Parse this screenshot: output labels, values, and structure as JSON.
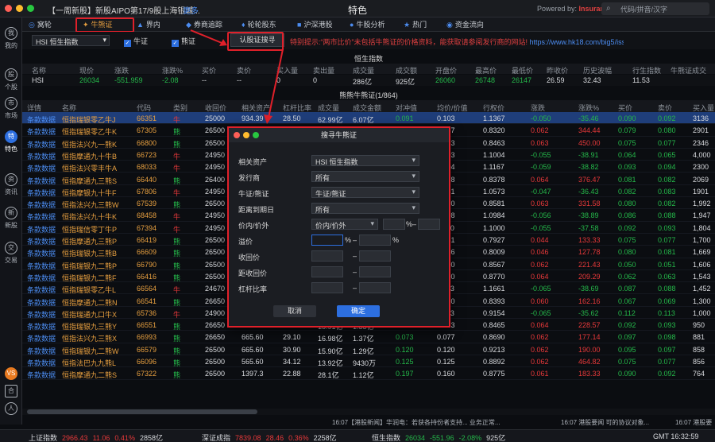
{
  "titlebar": {
    "ticker": "【一周新股】新股AIPO第17/9股上海银城...",
    "more": "更多",
    "title": "特色",
    "powered": "Powered by:",
    "brand": "Insurance",
    "search_placeholder": "代码/拼音/汉字"
  },
  "sidebar": {
    "items": [
      {
        "label": "我的",
        "icon": "我"
      },
      {
        "label": "个股",
        "icon": "股"
      },
      {
        "label": "市场",
        "icon": "市"
      },
      {
        "label": "特色",
        "icon": "特"
      },
      {
        "label": "资讯",
        "icon": "资"
      },
      {
        "label": "新股",
        "icon": "新"
      },
      {
        "label": "交易",
        "icon": "交"
      }
    ],
    "bottom": [
      {
        "icon": "VS"
      },
      {
        "icon": "合"
      },
      {
        "icon": "人"
      }
    ]
  },
  "tabs": [
    {
      "label": "窝轮",
      "icon": "◎"
    },
    {
      "label": "牛熊证",
      "icon": "✦"
    },
    {
      "label": "界内",
      "icon": "▲"
    },
    {
      "label": "券商追踪",
      "icon": "◆"
    },
    {
      "label": "轮轮股东",
      "icon": "♦"
    },
    {
      "label": "沪深港股",
      "icon": "■"
    },
    {
      "label": "牛股分析",
      "icon": "●"
    },
    {
      "label": "热门",
      "icon": "★"
    },
    {
      "label": "资金流向",
      "icon": "◉"
    }
  ],
  "filter": {
    "asset": "HSI 恒生指数",
    "check_bull": "牛证",
    "check_bear": "熊证",
    "search_btn": "认股证搜寻",
    "tip": "特别提示:“两市比价”未包括牛熊证的价格资料，能获取请参阅发行商的网站!",
    "url": "https://www.hk18.com/big5/issuer.htm"
  },
  "index": {
    "title": "恒生指数",
    "headers": [
      "名称",
      "现价",
      "涨跌",
      "涨跌%",
      "买价",
      "卖价",
      "买入量",
      "卖出量",
      "成交量",
      "成交额",
      "开盘价",
      "最高价",
      "最低价",
      "昨收价",
      "历史波幅",
      "行生指数",
      "牛熊证成交"
    ],
    "row": [
      "HSI",
      "26034",
      "-551.959",
      "-2.08",
      "--",
      "--",
      "0",
      "0",
      "286亿",
      "925亿",
      "26060",
      "26748",
      "26147",
      "26.59",
      "32.43",
      "11.53"
    ]
  },
  "table_title": "熊熊牛熊证(1/864)",
  "columns": [
    "详情",
    "名称",
    "代码",
    "类别",
    "收回价",
    "相关资产",
    "杠杆比率",
    "成交量",
    "成交金额",
    "对冲值",
    "均价/价值",
    "行权价",
    "涨跌",
    "涨跌%",
    "买价",
    "卖价",
    "买入量"
  ],
  "rows": [
    {
      "detail": "条款数据",
      "name": "恒指瑞银零乙牛J",
      "code": "66351",
      "type": "牛",
      "recall": "25000",
      "v1": "934.39",
      "v2": "28.50",
      "v3": "62.99亿",
      "v4": "6.07亿",
      "v5": "0.091",
      "v6": "0.103",
      "v7": "1.1367",
      "chg": "-0.050",
      "pct": "-35.46",
      "bid": "0.090",
      "ask": "0.092",
      "vol": "3136"
    },
    {
      "detail": "条款数据",
      "name": "恒指瑞银零乙牛K",
      "code": "67305",
      "type": "熊",
      "recall": "26500",
      "v1": "",
      "v2": "",
      "v3": "",
      "v4": "",
      "v5": "",
      "v6": "0.067",
      "v7": "0.8320",
      "chg": "0.062",
      "pct": "344.44",
      "bid": "0.079",
      "ask": "0.080",
      "vol": "2901"
    },
    {
      "detail": "条款数据",
      "name": "恒指法兴九一熊K",
      "code": "66800",
      "type": "熊",
      "recall": "26500",
      "v1": "",
      "v2": "",
      "v3": "",
      "v4": "",
      "v5": "",
      "v6": "0.063",
      "v7": "0.8463",
      "chg": "0.063",
      "pct": "450.00",
      "bid": "0.075",
      "ask": "0.077",
      "vol": "2346"
    },
    {
      "detail": "条款数据",
      "name": "恒指摩通九十牛B",
      "code": "66723",
      "type": "牛",
      "recall": "24950",
      "v1": "",
      "v2": "",
      "v3": "",
      "v4": "",
      "v5": "",
      "v6": "0.103",
      "v7": "1.1004",
      "chg": "-0.055",
      "pct": "-38.91",
      "bid": "0.064",
      "ask": "0.065",
      "vol": "4,000"
    },
    {
      "detail": "条款数据",
      "name": "恒指法兴零丰牛A",
      "code": "68033",
      "type": "牛",
      "recall": "24950",
      "v1": "",
      "v2": "",
      "v3": "",
      "v4": "",
      "v5": "",
      "v6": "0.104",
      "v7": "1.1167",
      "chg": "-0.059",
      "pct": "-38.82",
      "bid": "0.093",
      "ask": "0.094",
      "vol": "2300"
    },
    {
      "detail": "条款数据",
      "name": "恒指摩通九三熊S",
      "code": "66440",
      "type": "熊",
      "recall": "26400",
      "v1": "",
      "v2": "",
      "v3": "",
      "v4": "",
      "v5": "",
      "v6": "0.078",
      "v7": "0.8378",
      "chg": "0.064",
      "pct": "376.47",
      "bid": "0.081",
      "ask": "0.082",
      "vol": "2069"
    },
    {
      "detail": "条款数据",
      "name": "恒指摩银九十牛F",
      "code": "67806",
      "type": "牛",
      "recall": "24950",
      "v1": "",
      "v2": "",
      "v3": "",
      "v4": "",
      "v5": "",
      "v6": "0.061",
      "v7": "1.0573",
      "chg": "-0.047",
      "pct": "-36.43",
      "bid": "0.082",
      "ask": "0.083",
      "vol": "1901"
    },
    {
      "detail": "条款数据",
      "name": "恒指法兴九三熊W",
      "code": "67539",
      "type": "熊",
      "recall": "26500",
      "v1": "",
      "v2": "",
      "v3": "",
      "v4": "",
      "v5": "",
      "v6": "0.070",
      "v7": "0.8581",
      "chg": "0.063",
      "pct": "331.58",
      "bid": "0.080",
      "ask": "0.082",
      "vol": "1,992"
    },
    {
      "detail": "条款数据",
      "name": "恒指法兴九十牛K",
      "code": "68458",
      "type": "牛",
      "recall": "24950",
      "v1": "",
      "v2": "",
      "v3": "",
      "v4": "",
      "v5": "",
      "v6": "0.108",
      "v7": "1.0984",
      "chg": "-0.056",
      "pct": "-38.89",
      "bid": "0.086",
      "ask": "0.088",
      "vol": "1,947"
    },
    {
      "detail": "条款数据",
      "name": "恒指瑞信零丁牛P",
      "code": "67394",
      "type": "牛",
      "recall": "24950",
      "v1": "",
      "v2": "",
      "v3": "",
      "v4": "",
      "v5": "",
      "v6": "0.110",
      "v7": "1.1000",
      "chg": "-0.055",
      "pct": "-37.58",
      "bid": "0.092",
      "ask": "0.093",
      "vol": "1,804"
    },
    {
      "detail": "条款数据",
      "name": "恒指摩通九三熊P",
      "code": "66419",
      "type": "熊",
      "recall": "26500",
      "v1": "",
      "v2": "",
      "v3": "",
      "v4": "",
      "v5": "",
      "v6": "0.081",
      "v7": "0.7927",
      "chg": "0.044",
      "pct": "133.33",
      "bid": "0.075",
      "ask": "0.077",
      "vol": "1,700"
    },
    {
      "detail": "条款数据",
      "name": "恒指瑞银九三熊B",
      "code": "66609",
      "type": "熊",
      "recall": "26500",
      "v1": "",
      "v2": "",
      "v3": "",
      "v4": "",
      "v5": "",
      "v6": "0.086",
      "v7": "0.8009",
      "chg": "0.046",
      "pct": "127.78",
      "bid": "0.080",
      "ask": "0.081",
      "vol": "1,669"
    },
    {
      "detail": "条款数据",
      "name": "恒指瑞银九二熊P",
      "code": "66790",
      "type": "熊",
      "recall": "26500",
      "v1": "",
      "v2": "",
      "v3": "",
      "v4": "",
      "v5": "",
      "v6": "0.090",
      "v7": "0.8567",
      "chg": "0.062",
      "pct": "221.43",
      "bid": "0.050",
      "ask": "0.051",
      "vol": "1,606"
    },
    {
      "detail": "条款数据",
      "name": "恒指瑞银九二熊F",
      "code": "66416",
      "type": "熊",
      "recall": "26500",
      "v1": "",
      "v2": "",
      "v3": "",
      "v4": "",
      "v5": "",
      "v6": "0.090",
      "v7": "0.8770",
      "chg": "0.064",
      "pct": "209.29",
      "bid": "0.062",
      "ask": "0.063",
      "vol": "1,543"
    },
    {
      "detail": "条款数据",
      "name": "恒指瑞银零乙牛L",
      "code": "66564",
      "type": "牛",
      "recall": "24670",
      "v1": "",
      "v2": "",
      "v3": "",
      "v4": "",
      "v5": "",
      "v6": "0.113",
      "v7": "1.1661",
      "chg": "-0.065",
      "pct": "-38.69",
      "bid": "0.087",
      "ask": "0.088",
      "vol": "1,452"
    },
    {
      "detail": "条款数据",
      "name": "恒指摩通九二熊N",
      "code": "66541",
      "type": "熊",
      "recall": "26650",
      "v1": "",
      "v2": "",
      "v3": "",
      "v4": "",
      "v5": "",
      "v6": "0.060",
      "v7": "0.8393",
      "chg": "0.060",
      "pct": "162.16",
      "bid": "0.067",
      "ask": "0.069",
      "vol": "1,300"
    },
    {
      "detail": "条款数据",
      "name": "恒指瑞通九口牛X",
      "code": "65736",
      "type": "牛",
      "recall": "24900",
      "v1": "1034.39",
      "v2": "22.85",
      "v3": "18.98亿",
      "v4": "1.63亿",
      "v5": "0.113",
      "v6": "0.113",
      "v7": "0.9154",
      "chg": "-0.065",
      "pct": "-35.62",
      "bid": "0.112",
      "ask": "0.113",
      "vol": "1,000"
    },
    {
      "detail": "条款数据",
      "name": "恒指瑞银九三熊Y",
      "code": "66551",
      "type": "熊",
      "recall": "26650",
      "v1": "689.60",
      "v2": "25.10",
      "v3": "15.91亿",
      "v4": "1.33亿",
      "v5": "0.110",
      "v6": "0.083",
      "v7": "0.8465",
      "chg": "0.064",
      "pct": "228.57",
      "bid": "0.092",
      "ask": "0.093",
      "vol": "950"
    },
    {
      "detail": "条款数据",
      "name": "恒指法兴九三熊X",
      "code": "66993",
      "type": "熊",
      "recall": "26650",
      "v1": "665.60",
      "v2": "29.10",
      "v3": "16.98亿",
      "v4": "1.37亿",
      "v5": "0.073",
      "v6": "0.077",
      "v7": "0.8690",
      "chg": "0.062",
      "pct": "177.14",
      "bid": "0.097",
      "ask": "0.098",
      "vol": "881"
    },
    {
      "detail": "条款数据",
      "name": "恒指瑞银九二熊W",
      "code": "66579",
      "type": "熊",
      "recall": "26500",
      "v1": "665.60",
      "v2": "30.90",
      "v3": "15.90亿",
      "v4": "1.29亿",
      "v5": "0.120",
      "v6": "0.120",
      "v7": "0.9213",
      "chg": "0.062",
      "pct": "190.00",
      "bid": "0.095",
      "ask": "0.097",
      "vol": "858"
    },
    {
      "detail": "条款数据",
      "name": "恒指法巴九九熊L",
      "code": "66096",
      "type": "熊",
      "recall": "26500",
      "v1": "565.60",
      "v2": "34.12",
      "v3": "13.92亿",
      "v4": "9430万",
      "v5": "0.125",
      "v6": "0.125",
      "v7": "0.8892",
      "chg": "0.062",
      "pct": "464.82",
      "bid": "0.075",
      "ask": "0.077",
      "vol": "856"
    },
    {
      "detail": "条款数据",
      "name": "恒指摩通九二熊S",
      "code": "67322",
      "type": "熊",
      "recall": "26500",
      "v1": "1397.3",
      "v2": "22.88",
      "v3": "28.1亿",
      "v4": "1.12亿",
      "v5": "0.197",
      "v6": "0.160",
      "v7": "0.8775",
      "chg": "0.061",
      "pct": "183.33",
      "bid": "0.090",
      "ask": "0.092",
      "vol": "764"
    }
  ],
  "modal": {
    "title": "搜寻牛熊证",
    "fields": [
      {
        "label": "相关资产",
        "value": "HSI 恒生指数"
      },
      {
        "label": "发行商",
        "value": "所有"
      },
      {
        "label": "牛证/熊证",
        "value": "牛证/熊证"
      },
      {
        "label": "距离到期日",
        "value": "所有"
      },
      {
        "label": "价内/价外",
        "value": "价内/价外"
      },
      {
        "label": "溢价"
      },
      {
        "label": "收回价"
      },
      {
        "label": "距收回价"
      },
      {
        "label": "杠杆比率"
      }
    ],
    "pct": "%",
    "dash": "–",
    "cancel": "取消",
    "confirm": "确定"
  },
  "news": {
    "left": "16:07【港股新闻】华润电：若获各持份者支持... 业务正常...",
    "mid": "16:07 港股要闻 可的协议对象...",
    "right": "16:07 港股要"
  },
  "status": {
    "items": [
      {
        "name": "上证指数",
        "value": "2966.43",
        "chg": "11.06",
        "pct": "0.41%",
        "amount": "2858亿",
        "color": "red"
      },
      {
        "name": "深证成指",
        "value": "7839.08",
        "chg": "28.46",
        "pct": "0.36%",
        "amount": "2258亿",
        "color": "red"
      },
      {
        "name": "恒生指数",
        "value": "26034",
        "chg": "-551.96",
        "pct": "-2.08%",
        "amount": "925亿",
        "color": "green"
      }
    ],
    "clock": "GMT 16:32:59"
  }
}
